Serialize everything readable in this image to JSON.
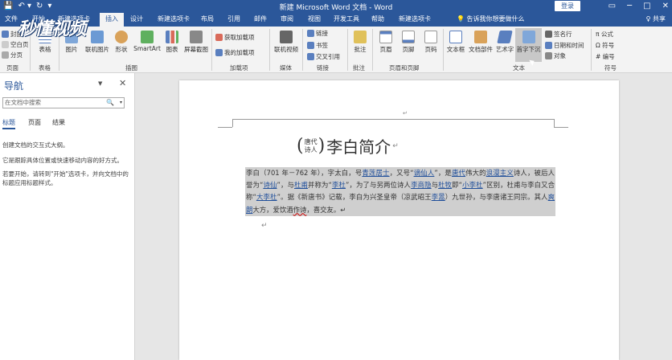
{
  "titlebar": {
    "doc_title": "新建 Microsoft Word 文档 - Word",
    "login": "登录",
    "qat": [
      "💾",
      "↶ ▾",
      "↻",
      "▾"
    ],
    "winctl": [
      "▭",
      "─",
      "□",
      "✕"
    ]
  },
  "logo": "秒懂视频",
  "tabs": [
    {
      "label": "文件"
    },
    {
      "label": "开始"
    },
    {
      "label": "新建选项卡"
    },
    {
      "label": "插入"
    },
    {
      "label": "设计"
    },
    {
      "label": "新建选项卡"
    },
    {
      "label": "布局"
    },
    {
      "label": "引用"
    },
    {
      "label": "邮件"
    },
    {
      "label": "审阅"
    },
    {
      "label": "视图"
    },
    {
      "label": "开发工具"
    },
    {
      "label": "帮助"
    },
    {
      "label": "新建选项卡"
    }
  ],
  "tell_me": "💡 告诉我你想要做什么",
  "share": "♀ 共享",
  "ribbon": {
    "pages": {
      "cover": "封面",
      "blank": "空白页",
      "break": "分页",
      "label": "页面"
    },
    "table": {
      "btn": "表格",
      "label": "表格"
    },
    "illus": {
      "pic": "图片",
      "online": "联机图片",
      "shape": "形状",
      "smart": "SmartArt",
      "chart": "图表",
      "screenshot": "屏幕截图",
      "label": "插图"
    },
    "addins": {
      "get": "获取加载项",
      "my": "我的加载项",
      "label": "加载项"
    },
    "media": {
      "video": "联机视频",
      "label": "媒体"
    },
    "links": {
      "link": "链接",
      "bookmark": "书签",
      "xref": "交叉引用",
      "label": "链接"
    },
    "comments": {
      "comment": "批注",
      "label": "批注"
    },
    "hf": {
      "header": "页眉",
      "footer": "页脚",
      "pagenum": "页码",
      "label": "页眉和页脚"
    },
    "text": {
      "textbox": "文本框",
      "parts": "文档部件",
      "wordart": "艺术字",
      "dropcap": "首字下沉",
      "sig": "签名行",
      "date": "日期和时间",
      "object": "对象",
      "label": "文本"
    },
    "symbols": {
      "eq": "π 公式",
      "sym": "Ω 符号",
      "num": "# 编号",
      "label": "符号"
    }
  },
  "nav": {
    "title": "导航",
    "search_placeholder": "在文档中搜索",
    "tabs": [
      "标题",
      "页面",
      "结果"
    ],
    "text1": "创建文档的交互式大纲。",
    "text2": "它是跟踪具体位置或快速移动内容的好方式。",
    "text3": "若要开始，请转到\"开始\"选项卡，并向文档中的标题应用标题样式。"
  },
  "document": {
    "title_paren_open": "(",
    "ruby_top": "唐代",
    "ruby_bottom": "诗人",
    "title_paren_close": ")",
    "title": "李白简介",
    "para_mark": "↵",
    "body": [
      {
        "t": "李白（701 年－762 年），字太白，号"
      },
      {
        "t": "青莲居士",
        "link": true
      },
      {
        "t": "，又号“"
      },
      {
        "t": "谪仙人",
        "link": true
      },
      {
        "t": "”，是"
      },
      {
        "t": "唐代",
        "link": true
      },
      {
        "t": "伟大的"
      },
      {
        "t": "浪漫主义",
        "link": true
      },
      {
        "t": "诗人，被后人誉为“"
      },
      {
        "t": "诗仙",
        "link": true
      },
      {
        "t": "”，与"
      },
      {
        "t": "杜甫",
        "link": true
      },
      {
        "t": "并称为“"
      },
      {
        "t": "李杜",
        "link": true
      },
      {
        "t": "”，为了与另两位诗人"
      },
      {
        "t": "李商隐",
        "link": true
      },
      {
        "t": "与"
      },
      {
        "t": "杜牧",
        "link": true
      },
      {
        "t": "即“"
      },
      {
        "t": "小李杜",
        "link": true
      },
      {
        "t": "”区别，杜甫与李白又合称“"
      },
      {
        "t": "大李杜",
        "link": true
      },
      {
        "t": "”。据《新唐书》记载，李白为兴圣皇帝（凉武昭王"
      },
      {
        "t": "李暠",
        "link": true
      },
      {
        "t": "）九世孙，与李唐诸王同宗。其人"
      },
      {
        "t": "爽朗",
        "link": true
      },
      {
        "t": "大方，爱饮酒"
      },
      {
        "t": "作诗",
        "squiggle": true
      },
      {
        "t": "，喜交友。↵"
      }
    ]
  }
}
